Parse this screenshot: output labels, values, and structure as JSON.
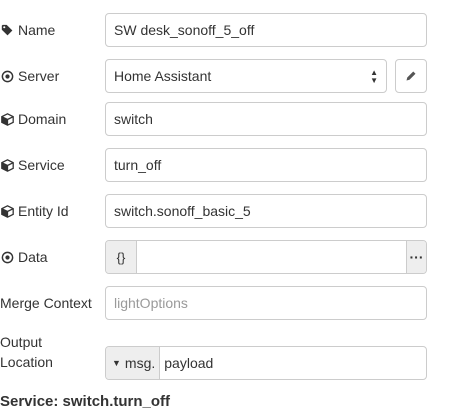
{
  "fields": {
    "name": {
      "label": "Name",
      "icon": "tag-icon",
      "value": "SW desk_sonoff_5_off"
    },
    "server": {
      "label": "Server",
      "icon": "dot-circle-icon",
      "value": "Home Assistant"
    },
    "domain": {
      "label": "Domain",
      "icon": "cube-icon",
      "value": "switch"
    },
    "service": {
      "label": "Service",
      "icon": "cube-icon",
      "value": "turn_off"
    },
    "entity_id": {
      "label": "Entity Id",
      "icon": "cube-icon",
      "value": "switch.sonoff_basic_5"
    },
    "data": {
      "label": "Data",
      "icon": "dot-circle-icon",
      "type": "{}",
      "value": "",
      "expand": "···"
    },
    "merge_context": {
      "label": "Merge Context",
      "value": "",
      "placeholder": "lightOptions"
    },
    "output_location": {
      "label_line1": "Output",
      "label_line2": "Location",
      "type": "msg.",
      "value": "payload"
    }
  },
  "summary": "Service: switch.turn_off"
}
